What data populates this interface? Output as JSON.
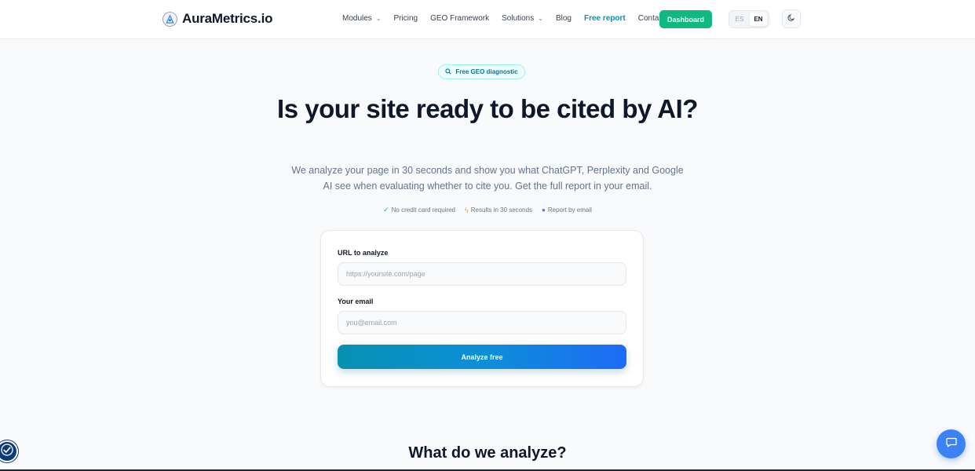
{
  "brand": {
    "name": "AuraMetrics.io",
    "logo_icon": "logo-icon"
  },
  "nav": {
    "items": [
      {
        "label": "Modules",
        "has_dropdown": true
      },
      {
        "label": "Pricing",
        "has_dropdown": false
      },
      {
        "label": "GEO Framework",
        "has_dropdown": false
      },
      {
        "label": "Solutions",
        "has_dropdown": true
      },
      {
        "label": "Blog",
        "has_dropdown": false
      },
      {
        "label": "Free report",
        "has_dropdown": false,
        "active": true
      },
      {
        "label": "Contact",
        "has_dropdown": false
      }
    ],
    "dashboard_label": "Dashboard",
    "languages": [
      {
        "code": "ES",
        "active": false
      },
      {
        "code": "EN",
        "active": true
      }
    ],
    "theme_icon": "moon-icon"
  },
  "hero": {
    "badge": "Free GEO diagnostic",
    "title": "Is your site ready to be cited by AI?",
    "subtitle": "We analyze your page in 30 seconds and show you what ChatGPT, Perplexity and Google AI see when evaluating whether to cite you. Get the full report in your email.",
    "features": [
      {
        "icon": "check-icon",
        "label": "No credit card required"
      },
      {
        "icon": "lightning-icon",
        "label": "Results in 30 seconds"
      },
      {
        "icon": "mail-icon",
        "label": "Report by email"
      }
    ]
  },
  "form": {
    "url_label": "URL to analyze",
    "url_placeholder": "https://yoursite.com/page",
    "url_value": "",
    "email_label": "Your email",
    "email_placeholder": "you@email.com",
    "email_value": "",
    "submit_label": "Analyze free"
  },
  "section": {
    "title": "What do we analyze?"
  },
  "colors": {
    "accent": "#0891b2",
    "primary_green": "#10b981",
    "button_gradient_start": "#0891b2",
    "button_gradient_end": "#1d6bf5",
    "chat_blue": "#3b82f6",
    "accessibility_navy": "#0b3a74"
  }
}
